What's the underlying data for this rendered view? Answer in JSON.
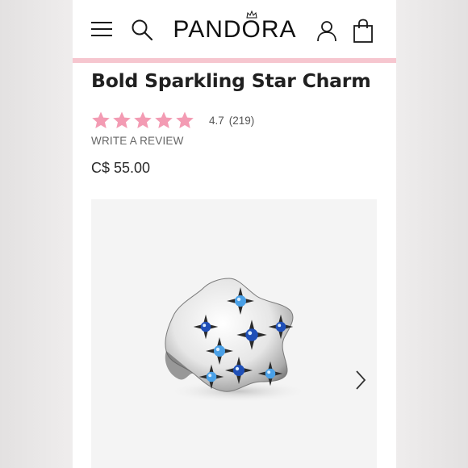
{
  "header": {
    "brand": "PANDORA",
    "icons": [
      "menu-icon",
      "search-icon",
      "account-icon",
      "shopping-bag-icon"
    ]
  },
  "product": {
    "title": "Bold Sparkling Star Charm",
    "rating_value": "4.7",
    "review_count": "(219)",
    "stars_filled": 5,
    "write_review": "WRITE A REVIEW",
    "price": "C$ 55.00"
  },
  "gallery": {
    "next_icon": "chevron-right-icon"
  },
  "colors": {
    "brand_pink": "#f6c6cf",
    "star_pink": "#f39bb3",
    "stone_blue": "#1f4fb7",
    "stone_light_blue": "#4aa0e6"
  }
}
